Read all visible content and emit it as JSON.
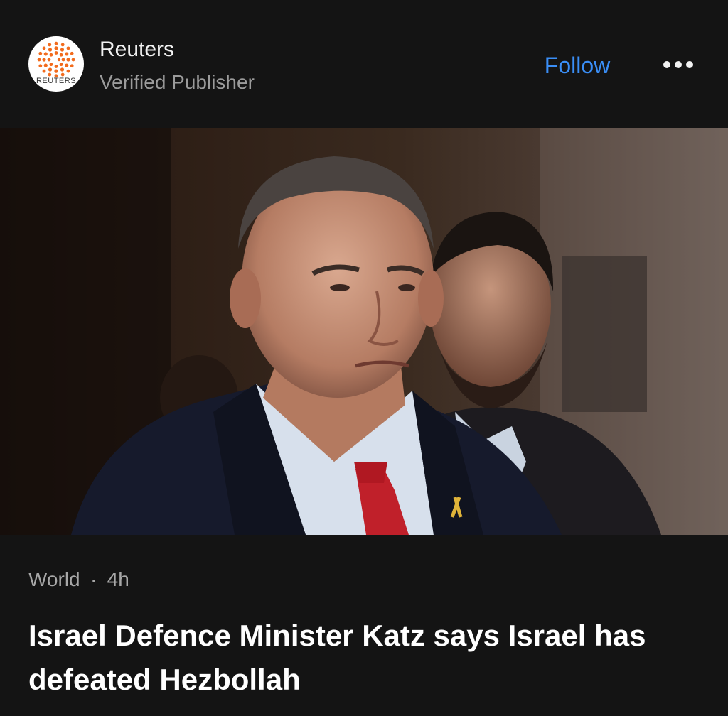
{
  "publisher": {
    "name": "Reuters",
    "subtitle": "Verified Publisher",
    "logo_text": "REUTERS",
    "logo_icon": "reuters-dot-sphere"
  },
  "actions": {
    "follow_label": "Follow",
    "more_icon": "ellipsis-horizontal"
  },
  "article": {
    "image_icon": "news-photo",
    "category": "World",
    "separator": "·",
    "age": "4h",
    "headline": "Israel Defence Minister Katz says Israel has defeated Hezbollah"
  },
  "colors": {
    "background": "#141414",
    "accent": "#3a8ef6",
    "secondary_text": "#9b9b9b",
    "logo_orange": "#f26b1d"
  }
}
